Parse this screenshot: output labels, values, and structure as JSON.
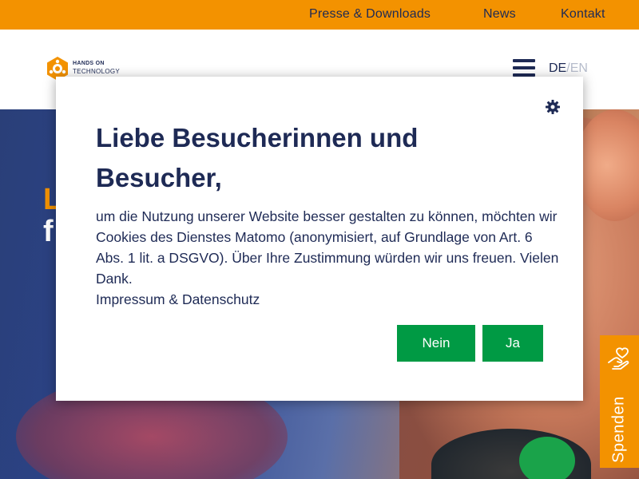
{
  "topnav": {
    "presse": "Presse & Downloads",
    "news": "News",
    "kontakt": "Kontakt"
  },
  "header": {
    "logo_line1": "HANDS ON",
    "logo_line2": "TECHNOLOGY",
    "lang_de": "DE",
    "lang_sep": "/",
    "lang_en": "EN"
  },
  "hero": {
    "heading_line1": "L",
    "heading_line2": "f"
  },
  "spenden": {
    "label": "Spenden"
  },
  "cookie_modal": {
    "title": "Liebe Besucherinnen und Besucher,",
    "body": "um die Nutzung unserer Website besser gestalten zu können, möchten wir Cookies des Dienstes Matomo (anonymisiert, auf Grundlage von Art. 6 Abs. 1 lit. a DSGVO). Über Ihre Zustimmung würden wir uns freuen. Vielen Dank.",
    "link": "Impressum & Datenschutz",
    "btn_no": "Nein",
    "btn_yes": "Ja"
  },
  "colors": {
    "orange": "#f39200",
    "navy": "#1e2a55",
    "green": "#009a44"
  },
  "icons": [
    "gear-icon",
    "menu-icon",
    "hand-heart-icon",
    "logo-icon"
  ]
}
